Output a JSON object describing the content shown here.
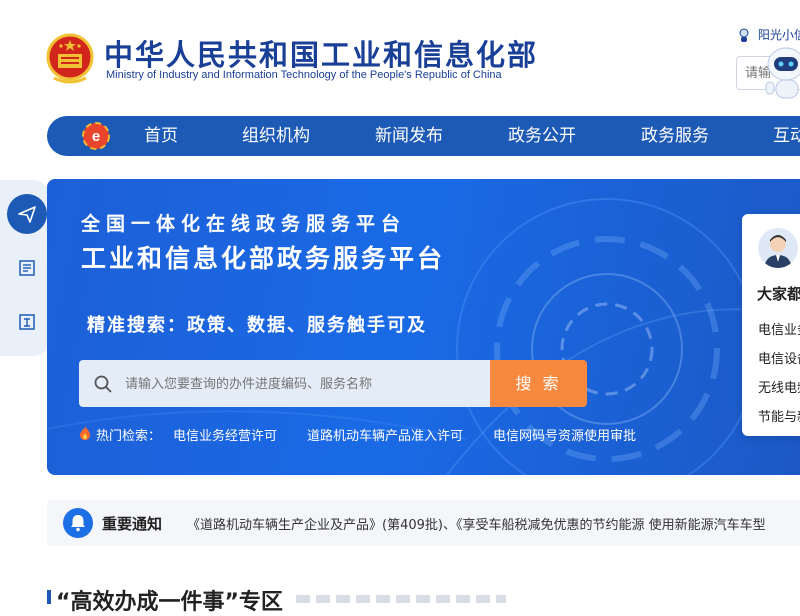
{
  "header": {
    "title_cn": "中华人民共和国工业和信息化部",
    "title_en": "Ministry of Industry and Information Technology of the People's Republic of China",
    "assistant_label": "阳光小信",
    "search_placeholder": "请输"
  },
  "nav": {
    "items": [
      {
        "label": "首页"
      },
      {
        "label": "组织机构"
      },
      {
        "label": "新闻发布"
      },
      {
        "label": "政务公开"
      },
      {
        "label": "政务服务"
      },
      {
        "label": "互动"
      }
    ]
  },
  "sidebar": {
    "icons": [
      "send-icon",
      "form-icon",
      "document-icon"
    ]
  },
  "banner": {
    "subtitle": "全国一体化在线政务服务平台",
    "title": "工业和信息化部政务服务平台",
    "slogan": "精准搜索：政策、数据、服务触手可及",
    "search_placeholder": "请输入您要查询的办件进度编码、服务名称",
    "search_button": "搜 索",
    "hot_label": "热门检索：",
    "hot_links": [
      "电信业务经营许可",
      "道路机动车辆产品准入许可",
      "电信网码号资源使用审批"
    ]
  },
  "card": {
    "title": "大家都",
    "items": [
      "电信业务",
      "电信设备",
      "无线电频",
      "节能与新"
    ]
  },
  "notice": {
    "label": "重要通知",
    "text": "《道路机动车辆生产企业及产品》(第409批)、《享受车船税减免优惠的节约能源 使用新能源汽车车型"
  },
  "section": {
    "title": "“高效办成一件事”专区"
  },
  "colors": {
    "brand_blue": "#1d5ab5",
    "banner_blue": "#1a6ae6",
    "search_orange": "#f7893f"
  }
}
